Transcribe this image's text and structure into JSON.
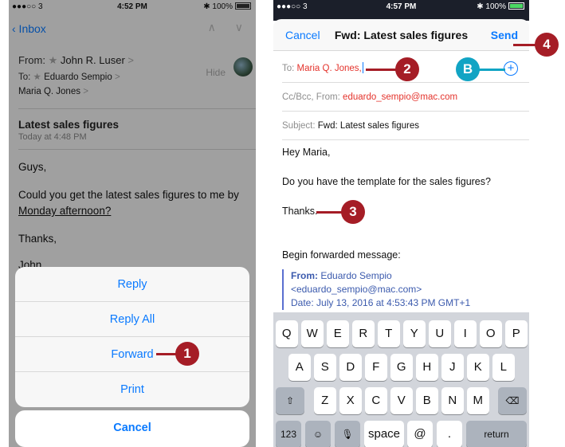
{
  "left": {
    "status": {
      "carrier": "●●●○○ 3 ",
      "time": "4:52 PM",
      "battery": "✱ 100%"
    },
    "nav": {
      "back": "‹ Inbox",
      "arrows": "∧ ∨"
    },
    "from": {
      "label": "From:",
      "star": "★",
      "name": "John R. Luser",
      "chevron": ">"
    },
    "to": {
      "label": "To:",
      "star": "★",
      "name": "Eduardo Sempio",
      "chevron": ">"
    },
    "cc": {
      "name": "Maria Q. Jones",
      "chevron": ">"
    },
    "hide": "Hide",
    "subject": "Latest sales figures",
    "date": "Today at 4:48 PM",
    "body": [
      "Guys,",
      "Could you get the latest sales figures to me by",
      "Monday afternoon?",
      "Thanks,",
      "John"
    ],
    "sheet": {
      "reply": "Reply",
      "reply_all": "Reply All",
      "forward": "Forward",
      "print": "Print",
      "cancel": "Cancel"
    }
  },
  "right": {
    "status": {
      "carrier": "●●●○○ 3 ",
      "time": "4:57 PM",
      "battery": "✱ 100%"
    },
    "compose": {
      "cancel": "Cancel",
      "title": "Fwd: Latest sales figures",
      "send": "Send"
    },
    "to": {
      "label": "To:",
      "value": "Maria Q. Jones,"
    },
    "ccbcc": {
      "label": "Cc/Bcc, From:",
      "value": "eduardo_sempio@mac.com"
    },
    "subject": {
      "label": "Subject:",
      "value": "Fwd: Latest sales figures"
    },
    "body": [
      "Hey Maria,",
      "Do you have the template for the sales figures?",
      "Thanks.",
      "Begin forwarded message:"
    ],
    "forwarded": {
      "from_label": "From:",
      "from_name": "Eduardo Sempio",
      "from_email": "<eduardo_sempio@mac.com>",
      "date_line": "Date: July 13, 2016 at 4:53:43 PM GMT+1"
    },
    "add_icon": "+",
    "keyboard": {
      "row1": [
        "Q",
        "W",
        "E",
        "R",
        "T",
        "Y",
        "U",
        "I",
        "O",
        "P"
      ],
      "row2": [
        "A",
        "S",
        "D",
        "F",
        "G",
        "H",
        "J",
        "K",
        "L"
      ],
      "row3": [
        "⇧",
        "Z",
        "X",
        "C",
        "V",
        "B",
        "N",
        "M",
        "⌫"
      ],
      "row4": [
        "123",
        "☺",
        "🎙",
        "space",
        "@",
        ".",
        "return"
      ]
    }
  },
  "callouts": [
    "1",
    "2",
    "3",
    "4",
    "B"
  ],
  "colors": {
    "callout_red": "#a51d26",
    "callout_teal": "#11a4c4",
    "ios_blue": "#0a7aff",
    "recipient_red": "#e4332c"
  }
}
